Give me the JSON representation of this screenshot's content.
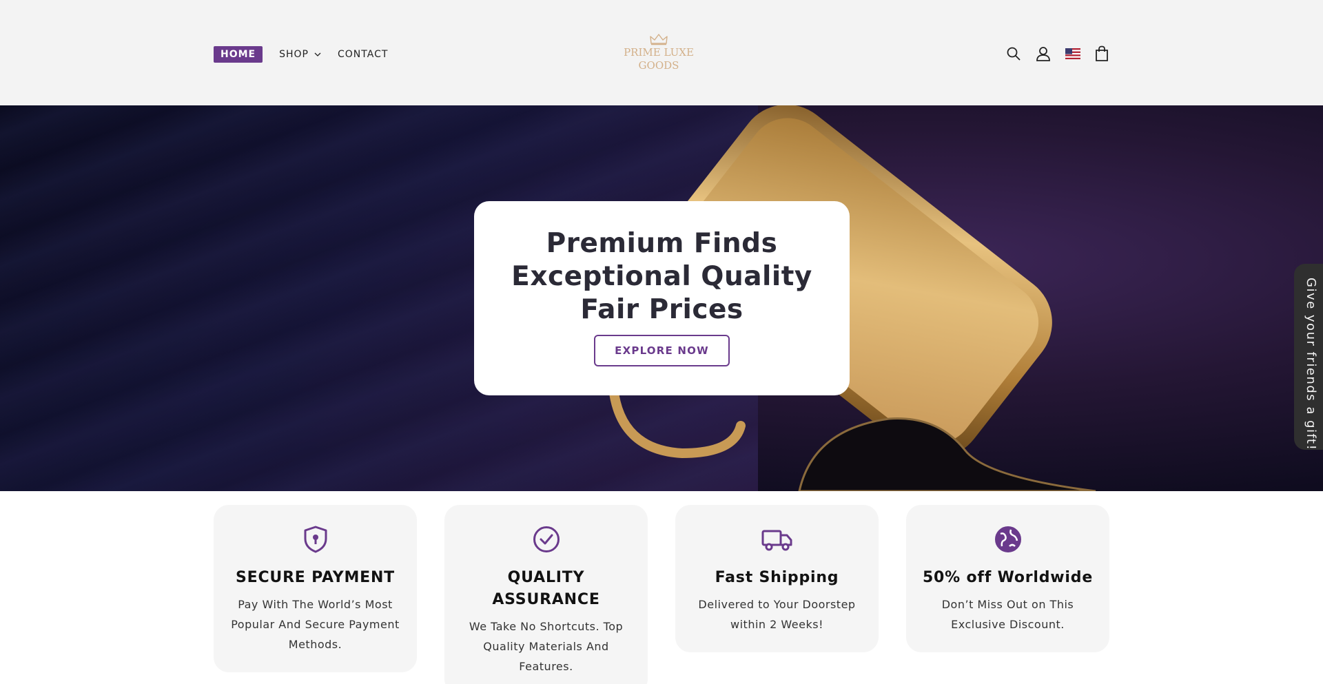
{
  "header": {
    "nav": [
      {
        "label": "HOME"
      },
      {
        "label": "SHOP"
      },
      {
        "label": "CONTACT"
      }
    ],
    "logo": {
      "line1": "PRIME LUXE",
      "line2": "GOODS"
    },
    "icons": [
      "search-icon",
      "account-icon",
      "us-flag-icon",
      "cart-icon"
    ]
  },
  "hero": {
    "title_lines": [
      "Premium Finds",
      "Exceptional Quality",
      "Fair Prices"
    ],
    "button_label": "EXPLORE NOW"
  },
  "gift_tab": {
    "label": "Give your friends a gift!"
  },
  "features": [
    {
      "icon": "shield-lock-icon",
      "title": "SECURE PAYMENT",
      "desc": "Pay With The World’s Most Popular And Secure Payment Methods."
    },
    {
      "icon": "check-circle-icon",
      "title": "QUALITY ASSURANCE",
      "desc": "We Take No Shortcuts. Top Quality Materials And Features."
    },
    {
      "icon": "truck-icon",
      "title": "Fast Shipping",
      "desc": "Delivered to Your Doorstep within 2 Weeks!"
    },
    {
      "icon": "globe-icon",
      "title": "50% off Worldwide",
      "desc": "Don’t Miss Out on This Exclusive Discount."
    }
  ],
  "colors": {
    "accent": "#6a3a8c",
    "logo_gold": "#d3b089",
    "header_bg": "#f3f3f3",
    "feature_bg": "#f5f5f5"
  }
}
